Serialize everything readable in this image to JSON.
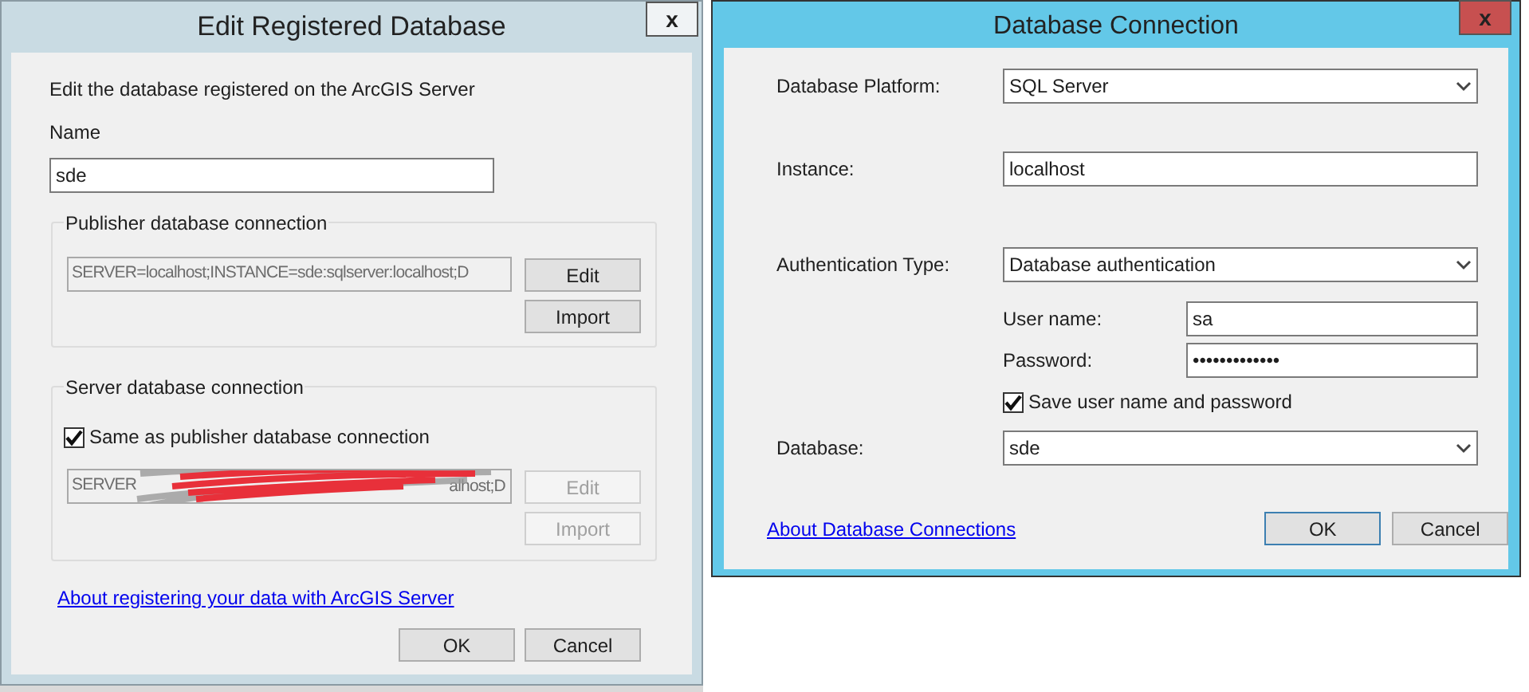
{
  "edit_dialog": {
    "title": "Edit Registered Database",
    "close": "x",
    "description": "Edit the database registered on the ArcGIS Server",
    "name_label": "Name",
    "name_value": "sde",
    "publisher_group": {
      "legend": "Publisher database connection",
      "value": "SERVER=localhost;INSTANCE=sde:sqlserver:localhost;D",
      "buttons": [
        {
          "label": "Edit",
          "disabled": false
        },
        {
          "label": "Import",
          "disabled": false
        }
      ]
    },
    "server_group": {
      "legend": "Server database connection",
      "checkbox": {
        "label": "Same as publisher database connection",
        "checked": true
      },
      "value_start": "SERVER",
      "value_end": "alhost;D",
      "redacted": true,
      "buttons": [
        {
          "label": "Edit",
          "disabled": true
        },
        {
          "label": "Import",
          "disabled": true
        }
      ]
    },
    "link": "About registering your data with ArcGIS Server",
    "buttons": [
      {
        "label": "OK",
        "default": false
      },
      {
        "label": "Cancel",
        "default": false
      }
    ]
  },
  "connection_dialog": {
    "title": "Database Connection",
    "close": "x",
    "rows": [
      {
        "kind": "select",
        "label": "Database Platform:",
        "value": "SQL Server"
      },
      {
        "kind": "input",
        "label": "Instance:",
        "value": "localhost"
      },
      {
        "kind": "select",
        "label": "Authentication Type:",
        "value": "Database authentication"
      }
    ],
    "credentials": [
      {
        "label": "User name:",
        "value": "sa"
      },
      {
        "label": "Password:",
        "value": "•••••••••••••"
      }
    ],
    "save_checkbox": {
      "label": "Save user name and password",
      "checked": true
    },
    "database": {
      "label": "Database:",
      "value": "sde"
    },
    "link": "About Database Connections",
    "buttons": [
      {
        "label": "OK",
        "default": true
      },
      {
        "label": "Cancel",
        "default": false
      }
    ]
  }
}
